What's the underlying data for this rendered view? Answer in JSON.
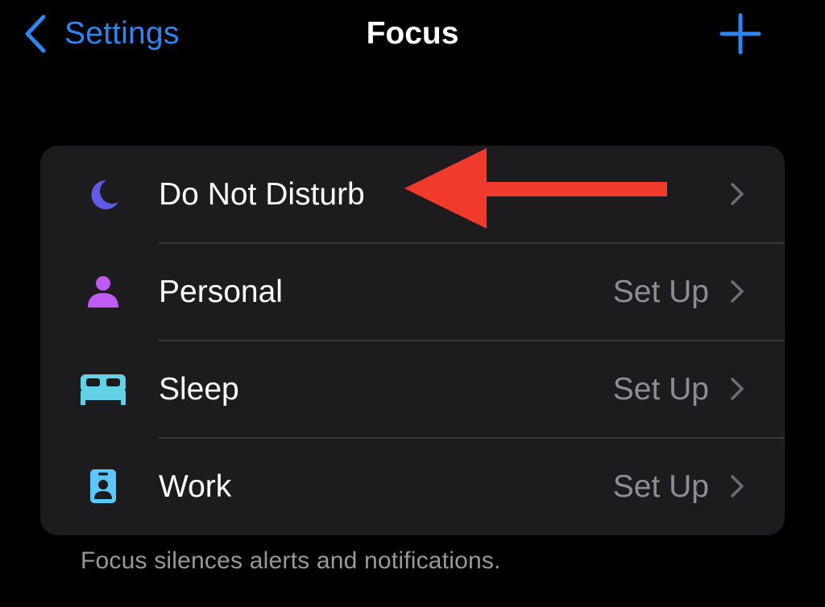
{
  "nav": {
    "back_label": "Settings",
    "title": "Focus",
    "add_icon": "plus-icon",
    "accent": "#2e86f5"
  },
  "focus_modes": [
    {
      "label": "Do Not Disturb",
      "value": "",
      "icon": "moon-icon",
      "icon_color": "#5e5ce6"
    },
    {
      "label": "Personal",
      "value": "Set Up",
      "icon": "person-icon",
      "icon_color": "#bf5af2"
    },
    {
      "label": "Sleep",
      "value": "Set Up",
      "icon": "bed-icon",
      "icon_color": "#64d2e6"
    },
    {
      "label": "Work",
      "value": "Set Up",
      "icon": "id-badge-icon",
      "icon_color": "#5ac8fa"
    }
  ],
  "footer": "Focus silences alerts and notifications.",
  "annotation": {
    "type": "red-arrow-pointer",
    "color": "#f03a2c",
    "points_to": "Do Not Disturb"
  }
}
